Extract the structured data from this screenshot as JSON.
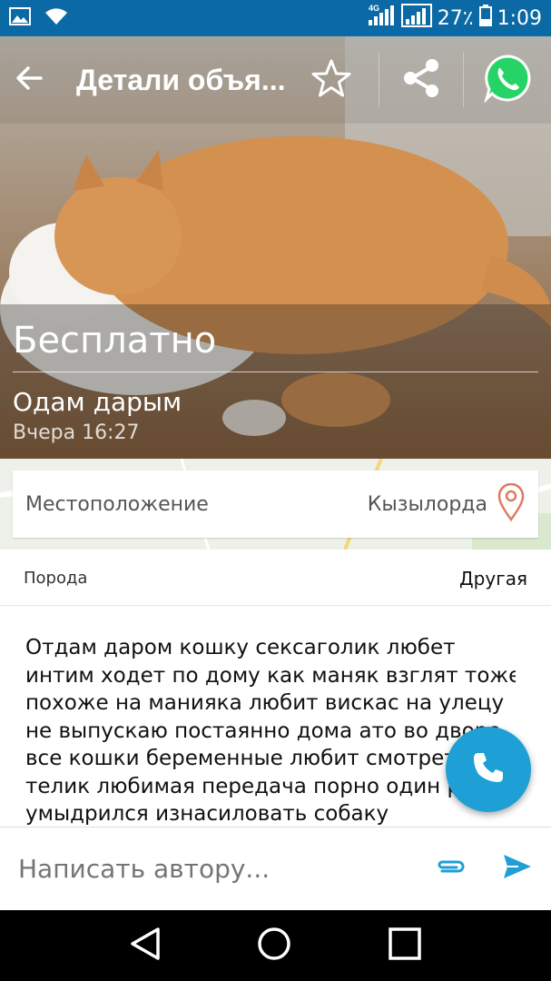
{
  "status_bar": {
    "network": "4G",
    "battery": "27٪",
    "time": "1:09"
  },
  "toolbar": {
    "title": "Детали объя...",
    "back_icon": "arrow-left-icon",
    "favorite_icon": "star-outline-icon",
    "share_icon": "share-icon",
    "whatsapp_icon": "whatsapp-icon"
  },
  "listing": {
    "price": "Бесплатно",
    "title": "Одам дарым",
    "date": "Вчера 16:27"
  },
  "location": {
    "label": "Местоположение",
    "value": "Кызылорда"
  },
  "breed": {
    "label": "Порода",
    "value": "Другая"
  },
  "description": {
    "lines": [
      "Отдам даром кошку  сексаголик любет",
      "интим  ходет по дому как маняк взглят тоже",
      "похоже на манияка любит вискас на улецу",
      "не выпускаю постаянно дома ато во дворе",
      "все кошки беременные любит смотреть",
      "телик любимая передача порно один раз",
      "умыдрился изнасиловать собаку"
    ]
  },
  "message": {
    "placeholder": "Написать автору..."
  },
  "colors": {
    "status_bar": "#0b6aa6",
    "accent": "#1e9fd6",
    "whatsapp": "#25d366",
    "pin": "#e07a5f"
  }
}
